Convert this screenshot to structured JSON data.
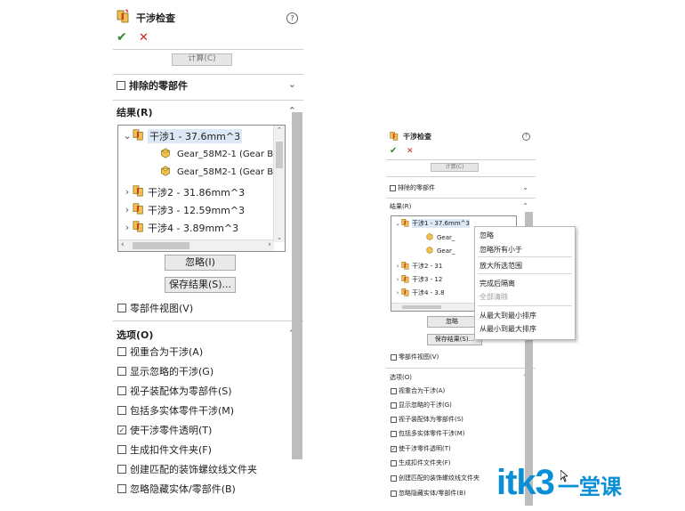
{
  "panel": {
    "title": "干涉检查",
    "help": "?",
    "ok": "✔",
    "cancel": "✕",
    "calculate": "计算(C)",
    "excluded_section": "排除的零部件",
    "results_section": "结果(R)",
    "tree": [
      {
        "label": "干涉1 - 37.6mm^3",
        "expanded": true
      },
      {
        "label": "Gear_58M2-1 (Gear Bl"
      },
      {
        "label": "Gear_58M2-1 (Gear Bl"
      },
      {
        "label": "干涉2 - 31.86mm^3"
      },
      {
        "label": "干涉3 - 12.59mm^3"
      },
      {
        "label": "干涉4 - 3.89mm^3"
      }
    ],
    "ignore_button": "忽略(I)",
    "save_results_button": "保存结果(S)...",
    "component_view": "零部件视图(V)",
    "options_section": "选项(O)",
    "options": [
      {
        "label": "视重合为干涉(A)",
        "checked": false
      },
      {
        "label": "显示忽略的干涉(G)",
        "checked": false
      },
      {
        "label": "视子装配体为零部件(S)",
        "checked": false
      },
      {
        "label": "包括多实体零件干涉(M)",
        "checked": false
      },
      {
        "label": "使干涉零件透明(T)",
        "checked": true
      },
      {
        "label": "生成扣件文件夹(F)",
        "checked": false
      },
      {
        "label": "创建匹配的装饰螺纹线文件夹",
        "checked": false
      },
      {
        "label": "忽略隐藏实体/零部件(B)",
        "checked": false
      }
    ]
  },
  "panel2": {
    "title": "干涉检查",
    "calculate": "计算(C)",
    "excluded_section": "排除的零部件",
    "results_section": "结果(R)",
    "tree": [
      {
        "label": "干涉1 - 37.6mm^3"
      },
      {
        "label": "Gear_"
      },
      {
        "label": "Gear_"
      },
      {
        "label": "干涉2 - 31"
      },
      {
        "label": "干涉3 - 12"
      },
      {
        "label": "干涉4 - 3.8"
      }
    ],
    "ignore_button": "忽略",
    "save_results_button": "保存结果(S)...",
    "component_view": "零部件视图(V)",
    "options_section": "选项(O)",
    "options": [
      {
        "label": "视重合为干涉(A)",
        "checked": false
      },
      {
        "label": "显示忽略的干涉(G)",
        "checked": false
      },
      {
        "label": "视子装配体为零部件(S)",
        "checked": false
      },
      {
        "label": "包括多实体零件干涉(M)",
        "checked": false
      },
      {
        "label": "使干涉零件透明(T)",
        "checked": true
      },
      {
        "label": "生成扣件文件夹(F)",
        "checked": false
      },
      {
        "label": "创建匹配的装饰螺纹线文件夹",
        "checked": false
      },
      {
        "label": "忽略隐藏实体/零部件(B)",
        "checked": false
      }
    ]
  },
  "context_menu": [
    {
      "label": "忽略",
      "disabled": false
    },
    {
      "label": "忽略所有小于",
      "disabled": false
    },
    {
      "label": "放大所选范围",
      "disabled": false
    },
    {
      "label": "完成后隔离",
      "disabled": false
    },
    {
      "label": "全部清除",
      "disabled": true
    },
    {
      "label": "从最大到最小排序",
      "disabled": false
    },
    {
      "label": "从最小到最大排序",
      "disabled": false
    }
  ],
  "watermark": {
    "latin": "itk3",
    "chinese": "一堂课"
  }
}
